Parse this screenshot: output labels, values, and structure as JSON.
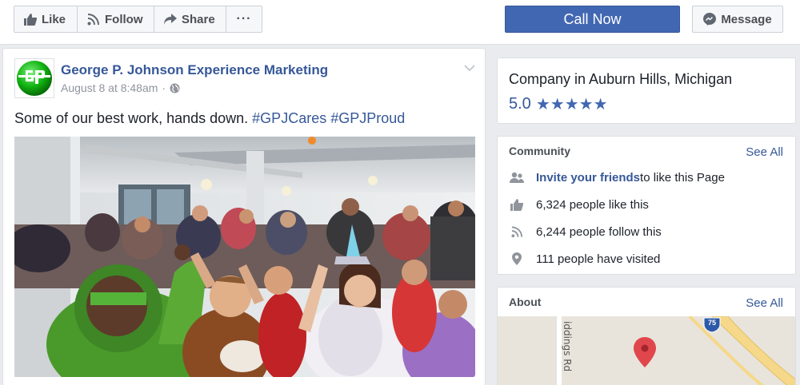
{
  "toolbar": {
    "like_label": "Like",
    "follow_label": "Follow",
    "share_label": "Share",
    "more_label": "···",
    "call_now_label": "Call Now",
    "message_label": "Message"
  },
  "post": {
    "page_name": "George P. Johnson Experience Marketing",
    "date": "August 8 at 8:48am",
    "separator": "·",
    "text_plain": "Some of our best work, hands down. ",
    "hashtag_1": "#GPJCares",
    "hashtag_2": "#GPJProud",
    "avatar_letters": "GJP"
  },
  "company": {
    "category_line": "Company in Auburn Hills, Michigan",
    "rating": "5.0",
    "stars": 5
  },
  "community": {
    "title": "Community",
    "see_all": "See All",
    "invite_link": "Invite your friends",
    "invite_rest": " to like this Page",
    "likes": "6,324 people like this",
    "follows": "6,244 people follow this",
    "visits": "111 people have visited"
  },
  "about": {
    "title": "About",
    "see_all": "See All",
    "road_label": "iddings Rd",
    "highway_label": "75"
  },
  "colors": {
    "facebook_blue": "#4267b2",
    "link_blue": "#365899",
    "map_pin": "#e0474c"
  },
  "icons": [
    "like-icon",
    "follow-icon",
    "share-icon",
    "more-icon",
    "messenger-icon",
    "globe-icon",
    "chevron-down-icon",
    "star-icon",
    "invite-icon",
    "thumb-icon",
    "rss-icon",
    "location-icon",
    "map-pin-icon",
    "highway-shield-icon"
  ]
}
